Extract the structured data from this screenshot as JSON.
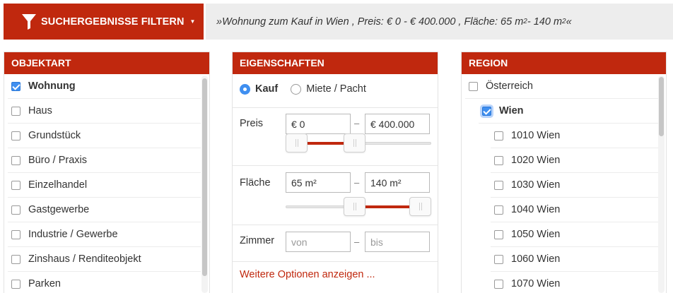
{
  "topbar": {
    "filter_button_label": "SUCHERGEBNISSE FILTERN",
    "summary_prefix": "»Wohnung zum Kauf in Wien , Preis: € 0 - € 400.000 , Fläche: 65 m",
    "summary_mid": " - 140 m",
    "summary_suffix": "«",
    "sup": "2"
  },
  "objektart": {
    "title": "OBJEKTART",
    "items": [
      {
        "label": "Wohnung",
        "checked": true
      },
      {
        "label": "Haus",
        "checked": false
      },
      {
        "label": "Grundstück",
        "checked": false
      },
      {
        "label": "Büro / Praxis",
        "checked": false
      },
      {
        "label": "Einzelhandel",
        "checked": false
      },
      {
        "label": "Gastgewerbe",
        "checked": false
      },
      {
        "label": "Industrie / Gewerbe",
        "checked": false
      },
      {
        "label": "Zinshaus / Renditeobjekt",
        "checked": false
      },
      {
        "label": "Parken",
        "checked": false
      }
    ]
  },
  "eigenschaften": {
    "title": "EIGENSCHAFTEN",
    "radio_kauf": "Kauf",
    "radio_miete": "Miete / Pacht",
    "selected": "Kauf",
    "preis": {
      "label": "Preis",
      "min": "€ 0",
      "max": "€ 400.000",
      "dash": "–",
      "range_fraction": [
        0.0,
        0.47
      ]
    },
    "flaeche": {
      "label": "Fläche",
      "min": "65 m²",
      "max": "140 m²",
      "dash": "–",
      "range_fraction": [
        0.47,
        1.0
      ]
    },
    "zimmer": {
      "label": "Zimmer",
      "min_placeholder": "von",
      "max_placeholder": "bis",
      "dash": "–"
    },
    "more_link": "Weitere Optionen anzeigen ..."
  },
  "region": {
    "title": "REGION",
    "items": [
      {
        "label": "Österreich",
        "checked": false,
        "level": 0
      },
      {
        "label": "Wien",
        "checked": true,
        "level": 1
      },
      {
        "label": "1010 Wien",
        "checked": false,
        "level": 2
      },
      {
        "label": "1020 Wien",
        "checked": false,
        "level": 2
      },
      {
        "label": "1030 Wien",
        "checked": false,
        "level": 2
      },
      {
        "label": "1040 Wien",
        "checked": false,
        "level": 2
      },
      {
        "label": "1050 Wien",
        "checked": false,
        "level": 2
      },
      {
        "label": "1060 Wien",
        "checked": false,
        "level": 2
      },
      {
        "label": "1070 Wien",
        "checked": false,
        "level": 2
      }
    ]
  },
  "colors": {
    "accent": "#c0280e",
    "checkbox_blue": "#3f8ff0",
    "summary_bg": "#ededed"
  },
  "icons": {
    "filter": "funnel-icon",
    "dropdown": "caret-down-icon"
  }
}
